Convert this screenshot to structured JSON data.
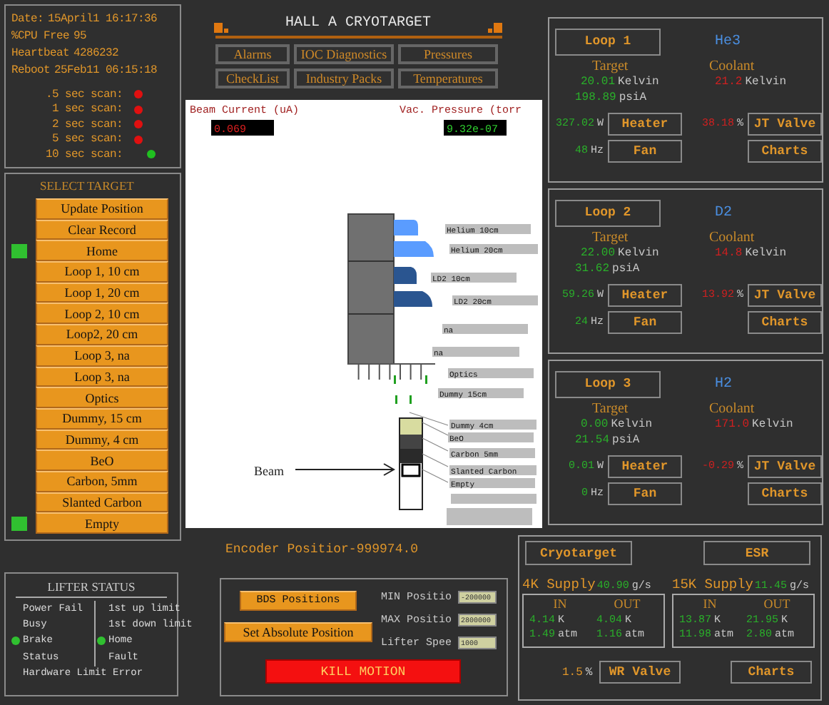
{
  "status": {
    "lines": [
      {
        "label": "Date:",
        "value": "15April1 16:17:36"
      },
      {
        "label": "%CPU Free",
        "value": "95"
      },
      {
        "label": "Heartbeat",
        "value": "4286232"
      },
      {
        "label": "Reboot",
        "value": "25Feb11 06:15:18"
      }
    ],
    "scans": [
      {
        "label": ".5 sec scan:",
        "color": "#e01010"
      },
      {
        "label": "1 sec scan:",
        "color": "#e01010"
      },
      {
        "label": "2 sec scan:",
        "color": "#e01010"
      },
      {
        "label": "5 sec scan:",
        "color": "#e01010"
      },
      {
        "label": "10 sec scan:",
        "color": "#20c020"
      }
    ]
  },
  "select_target": {
    "title": "SELECT TARGET",
    "items": [
      {
        "label": "Update Position",
        "indicator": false
      },
      {
        "label": "Clear Record",
        "indicator": false
      },
      {
        "label": "Home",
        "indicator": true
      },
      {
        "label": "Loop 1, 10 cm",
        "indicator": false
      },
      {
        "label": "Loop 1, 20 cm",
        "indicator": false
      },
      {
        "label": "Loop 2, 10 cm",
        "indicator": false
      },
      {
        "label": "Loop2, 20 cm",
        "indicator": false
      },
      {
        "label": "Loop 3, na",
        "indicator": false
      },
      {
        "label": "Loop 3, na",
        "indicator": false
      },
      {
        "label": "Optics",
        "indicator": false
      },
      {
        "label": "Dummy, 15 cm",
        "indicator": false
      },
      {
        "label": "Dummy, 4 cm",
        "indicator": false
      },
      {
        "label": "BeO",
        "indicator": false
      },
      {
        "label": "Carbon, 5mm",
        "indicator": false
      },
      {
        "label": "Slanted Carbon",
        "indicator": false
      },
      {
        "label": "Empty",
        "indicator": true
      }
    ]
  },
  "lifter_status": {
    "title": "LIFTER STATUS",
    "left": [
      {
        "label": "Power Fail",
        "on": false
      },
      {
        "label": "Busy",
        "on": false
      },
      {
        "label": "Brake",
        "on": true
      },
      {
        "label": "Status",
        "on": false
      },
      {
        "label": "Hardware Limit Error",
        "on": false
      }
    ],
    "right": [
      {
        "label": "1st up limit",
        "on": false
      },
      {
        "label": "1st down limit",
        "on": false
      },
      {
        "label": "Home",
        "on": true
      },
      {
        "label": "Fault",
        "on": false
      }
    ]
  },
  "header": {
    "title": "HALL A CRYOTARGET",
    "nav": [
      "Alarms",
      "IOC Diagnostics",
      "Pressures",
      "CheckList",
      "Industry Packs",
      "Temperatures"
    ]
  },
  "readouts": [
    {
      "label": "Beam Current (uA)",
      "value": "0.069",
      "kind": "current"
    },
    {
      "label": "Vac. Pressure (torr",
      "value": "9.32e-07",
      "kind": "pressure"
    }
  ],
  "targets_diagram": {
    "labels": [
      "Helium 10cm",
      "Helium 20cm",
      "LD2 10cm",
      "LD2 20cm",
      "na",
      "na",
      "Optics",
      "Dummy 15cm",
      "Dummy 4cm",
      "BeO",
      "Carbon 5mm",
      "Slanted Carbon",
      "Empty"
    ],
    "beam_label": "Beam"
  },
  "encoder": "Encoder Positior-999974.0",
  "lifter_controls": {
    "buttons": [
      "BDS Positions",
      "Set Absolute Position"
    ],
    "fields": [
      {
        "label": "MIN Positio",
        "value": "-200000"
      },
      {
        "label": "MAX Positio",
        "value": "2800000"
      },
      {
        "label": "Lifter Spee",
        "value": "1000"
      }
    ],
    "kill": "KILL MOTION"
  },
  "loops": [
    {
      "name": "Loop 1",
      "fluid": "He3",
      "target_label": "Target",
      "coolant_label": "Coolant",
      "target_temp": {
        "value": "20.01",
        "unit": "Kelvin"
      },
      "target_pressure": {
        "value": "198.89",
        "unit": "psiA"
      },
      "coolant_temp": {
        "value": "21.2",
        "unit": "Kelvin"
      },
      "heater": {
        "value": "327.02",
        "unit": "W"
      },
      "fan": {
        "value": "48",
        "unit": "Hz"
      },
      "jt_valve": {
        "value": "38.18",
        "unit": "%"
      },
      "buttons": [
        "Heater",
        "JT Valve",
        "Fan",
        "Charts"
      ]
    },
    {
      "name": "Loop 2",
      "fluid": "D2",
      "target_label": "Target",
      "coolant_label": "Coolant",
      "target_temp": {
        "value": "22.00",
        "unit": "Kelvin"
      },
      "target_pressure": {
        "value": "31.62",
        "unit": "psiA"
      },
      "coolant_temp": {
        "value": "14.8",
        "unit": "Kelvin"
      },
      "heater": {
        "value": "59.26",
        "unit": "W"
      },
      "fan": {
        "value": "24",
        "unit": "Hz"
      },
      "jt_valve": {
        "value": "13.92",
        "unit": "%"
      },
      "buttons": [
        "Heater",
        "JT Valve",
        "Fan",
        "Charts"
      ]
    },
    {
      "name": "Loop 3",
      "fluid": "H2",
      "target_label": "Target",
      "coolant_label": "Coolant",
      "target_temp": {
        "value": "0.00",
        "unit": "Kelvin"
      },
      "target_pressure": {
        "value": "21.54",
        "unit": "psiA"
      },
      "coolant_temp": {
        "value": "171.0",
        "unit": "Kelvin"
      },
      "heater": {
        "value": "0.01",
        "unit": "W"
      },
      "fan": {
        "value": "0",
        "unit": "Hz"
      },
      "jt_valve": {
        "value": "-0.29",
        "unit": "%"
      },
      "buttons": [
        "Heater",
        "JT Valve",
        "Fan",
        "Charts"
      ]
    }
  ],
  "supply": {
    "buttons": [
      "Cryotarget",
      "ESR"
    ],
    "supplies": [
      {
        "label": "4K Supply",
        "flow": "40.90",
        "unit": "g/s",
        "in_label": "IN",
        "out_label": "OUT",
        "cells": [
          {
            "value": "4.14",
            "unit": "K"
          },
          {
            "value": "4.04",
            "unit": "K"
          },
          {
            "value": "1.49",
            "unit": "atm"
          },
          {
            "value": "1.16",
            "unit": "atm"
          }
        ]
      },
      {
        "label": "15K Supply",
        "flow": "11.45",
        "unit": "g/s",
        "in_label": "IN",
        "out_label": "OUT",
        "cells": [
          {
            "value": "13.87",
            "unit": "K"
          },
          {
            "value": "21.95",
            "unit": "K"
          },
          {
            "value": "11.98",
            "unit": "atm"
          },
          {
            "value": "2.80",
            "unit": "atm"
          }
        ]
      }
    ],
    "wr_value": "1.5",
    "wr_unit": "%",
    "wr_button": "WR Valve",
    "charts_button": "Charts"
  }
}
